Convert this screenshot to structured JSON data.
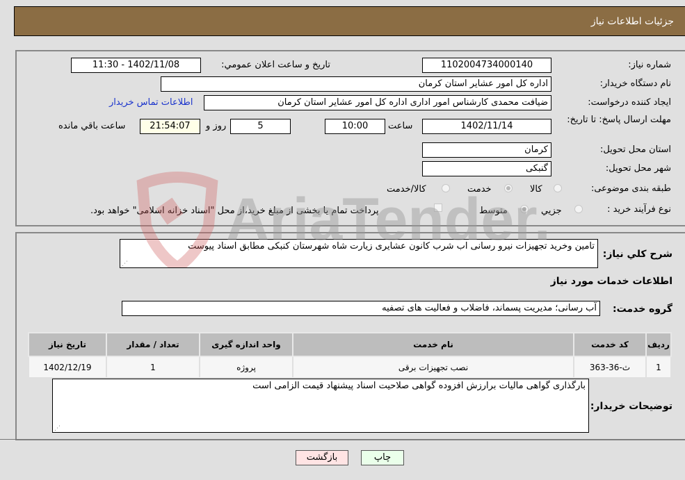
{
  "header": {
    "title": "جزئیات اطلاعات نیاز"
  },
  "form": {
    "need_number": {
      "label": "شماره نیاز:",
      "value": "1102004734000140"
    },
    "announce_datetime": {
      "label": "تاریخ و ساعت اعلان عمومي:",
      "value": "1402/11/08 - 11:30"
    },
    "buyer_org": {
      "label": "نام دستگاه خريدار:",
      "value": "اداره کل امور عشایر استان کرمان"
    },
    "requester": {
      "label": "ایجاد کننده درخواست:",
      "value": "ضیافت محمدی کارشناس امور اداری اداره کل امور عشایر استان کرمان"
    },
    "buyer_contact_link": "اطلاعات تماس خریدار",
    "deadline": {
      "label": "مهلت ارسال پاسخ: تا تاریخ:",
      "date": "1402/11/14",
      "time_label": "ساعت",
      "time": "10:00",
      "days": "5",
      "days_label": "روز و",
      "remaining": "21:54:07",
      "remaining_label": "ساعت باقي مانده"
    },
    "province": {
      "label": "استان محل تحویل:",
      "value": "کرمان"
    },
    "city": {
      "label": "شهر محل تحویل:",
      "value": "گنبکی"
    },
    "category": {
      "label": "طبقه بندی موضوعی:",
      "options": [
        "کالا",
        "خدمت",
        "کالا/خدمت"
      ],
      "selected": "خدمت"
    },
    "purchase_type": {
      "label": "نوع فرآیند خرید :",
      "options": [
        "جزيي",
        "متوسط"
      ],
      "selected": "متوسط",
      "treasury_note": "پرداخت تمام یا بخشی از مبلغ خرید،از محل \"اسناد خزانه اسلامی\" خواهد بود."
    }
  },
  "details": {
    "description_label": "شرح کلي نياز:",
    "description": "تامین وخرید تجهیزات نیرو رسانی اب شرب کانون عشایری زیارت شاه شهرستان کنبکی مطابق اسناد پیوست",
    "services_heading": "اطلاعات خدمات مورد نياز",
    "service_group_label": "گروه خدمت:",
    "service_group": "آب رسانی؛ مدیریت پسماند، فاضلاب و فعالیت های تصفیه",
    "table": {
      "headers": [
        "رديف",
        "کد خدمت",
        "نام خدمت",
        "واحد اندازه گيری",
        "تعداد / مقدار",
        "تاريخ نياز"
      ],
      "rows": [
        [
          "1",
          "ث-36-363",
          "نصب تجهیزات برقی",
          "پروژه",
          "1",
          "1402/12/19"
        ]
      ]
    },
    "buyer_notes_label": "توضيحات خريدار:",
    "buyer_notes": "بارگذاری گواهی مالیات برارزش افزوده گواهی صلاحیت اسناد پیشنهاد قیمت الزامی است"
  },
  "buttons": {
    "print": "چاپ",
    "back": "بازگشت"
  },
  "watermark": {
    "text": "AriaTender.neT"
  },
  "colors": {
    "header_bg": "#8b6d44",
    "link": "#1a33cc",
    "print_bg": "#eaffea",
    "back_bg": "#ffe4e4"
  }
}
